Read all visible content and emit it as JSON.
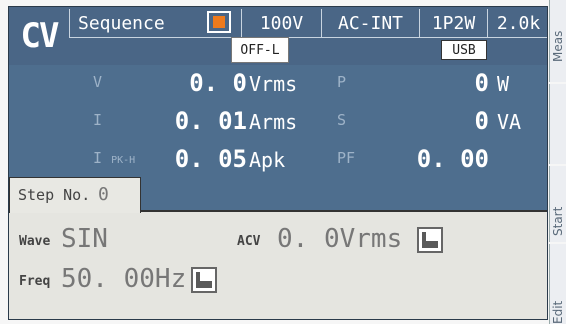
{
  "header": {
    "mode": "CV",
    "function": "Sequence",
    "range": "100V",
    "source": "AC-INT",
    "wiring": "1P2W",
    "frequency_range": "2.0k",
    "output_state": "OFF-L",
    "interface": "USB",
    "stop_icon_color": "#ee7a1c"
  },
  "measurements": {
    "v": {
      "label": "V",
      "value": "0. 0",
      "unit": "Vrms"
    },
    "i": {
      "label": "I",
      "value": "0. 01",
      "unit": "Arms"
    },
    "ipk": {
      "label": "I",
      "sub": "PK-H",
      "value": "0. 05",
      "unit": "Apk"
    },
    "p": {
      "label": "P",
      "value": "0",
      "unit": "W"
    },
    "s": {
      "label": "S",
      "value": "0",
      "unit": "VA"
    },
    "pf": {
      "label": "PF",
      "value": "0. 00"
    }
  },
  "step": {
    "label": "Step No.",
    "value": "0"
  },
  "edit": {
    "wave_label": "Wave",
    "wave_value": "SIN",
    "acv_label": "ACV",
    "acv_value": "0. 0Vrms",
    "freq_label": "Freq",
    "freq_value": "50. 00Hz"
  },
  "softkeys": [
    "Meas",
    "Start",
    "Edit"
  ]
}
